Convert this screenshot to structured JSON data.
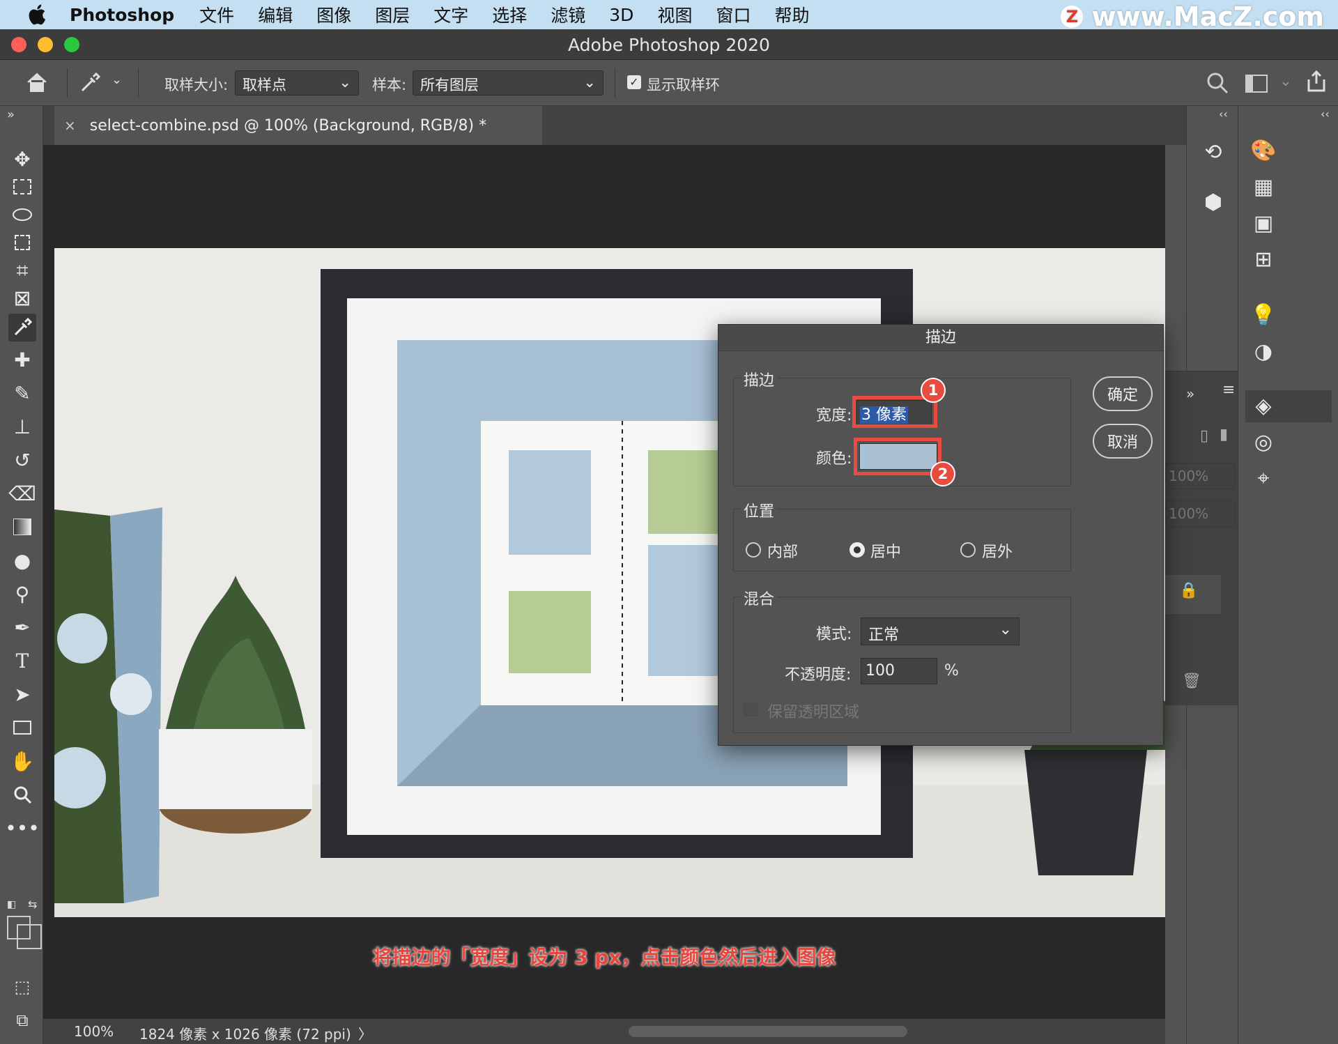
{
  "menubar": {
    "app_name": "Photoshop",
    "items": [
      "文件",
      "编辑",
      "图像",
      "图层",
      "文字",
      "选择",
      "滤镜",
      "3D",
      "视图",
      "窗口",
      "帮助"
    ],
    "watermark": "www.MacZ.com",
    "watermark_logo": "Z"
  },
  "window": {
    "title": "Adobe Photoshop 2020",
    "traffic_colors": [
      "#fe5f57",
      "#febc2e",
      "#28c840"
    ]
  },
  "options": {
    "sample_size_label": "取样大小:",
    "sample_size_value": "取样点",
    "sample_label": "样本:",
    "sample_value": "所有图层",
    "show_ring_label": "显示取样环",
    "show_ring_checked": true
  },
  "document": {
    "tab_title": "select-combine.psd @ 100% (Background, RGB/8) *",
    "close_glyph": "×"
  },
  "status": {
    "zoom": "100%",
    "info": "1824 像素 x 1026 像素 (72 ppi)",
    "arrow": "〉"
  },
  "caption": "将描边的「宽度」设为 3 px，点击颜色然后进入图像",
  "panels": {
    "expand_left": "»",
    "collapse_right": "‹‹",
    "opacity_1": "100%",
    "opacity_2": "100%"
  },
  "dialog": {
    "title": "描边",
    "stroke_group": "描边",
    "width_label": "宽度:",
    "width_value": "3 像素",
    "color_label": "颜色:",
    "color_swatch": "#a9c1d3",
    "position_group": "位置",
    "pos_inside": "内部",
    "pos_center": "居中",
    "pos_outside": "居外",
    "pos_selected": "center",
    "blend_group": "混合",
    "mode_label": "模式:",
    "mode_value": "正常",
    "opacity_label": "不透明度:",
    "opacity_value": "100",
    "opacity_unit": "%",
    "preserve_label": "保留透明区域",
    "ok_label": "确定",
    "cancel_label": "取消",
    "badge_1": "1",
    "badge_2": "2",
    "highlight_color": "#ea4b3f"
  },
  "tools": [
    "move-icon",
    "marquee-icon",
    "lasso-icon",
    "object-select-icon",
    "crop-icon",
    "frame-icon",
    "eyedropper-icon",
    "healing-icon",
    "brush-icon",
    "stamp-icon",
    "history-brush-icon",
    "eraser-icon",
    "gradient-icon",
    "blur-icon",
    "dodge-icon",
    "pen-icon",
    "type-icon",
    "path-select-icon",
    "rectangle-icon",
    "hand-icon",
    "zoom-icon",
    "more-icon"
  ],
  "colors": {
    "foreground": "#b9cee0",
    "background": "#ffffff"
  }
}
